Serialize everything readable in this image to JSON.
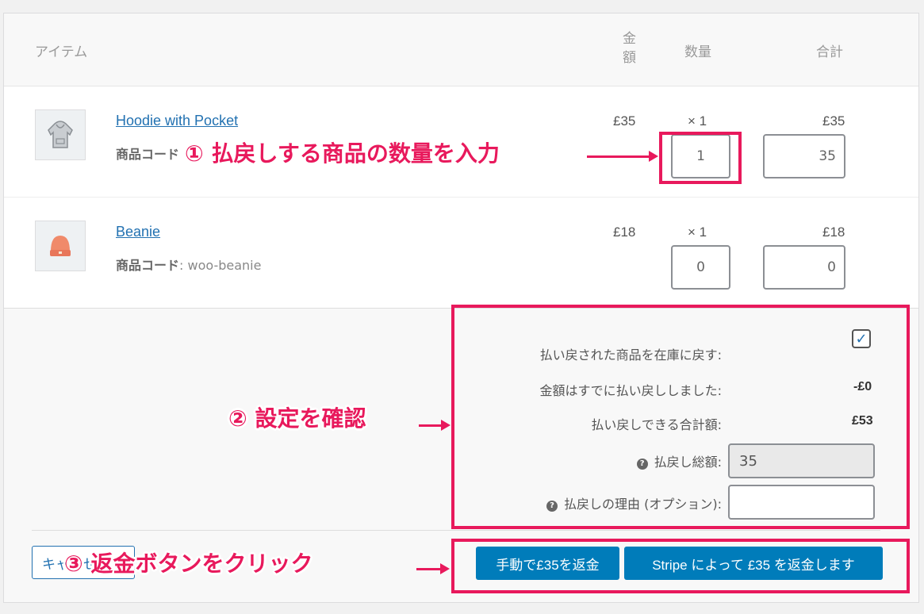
{
  "header": {
    "item": "アイテム",
    "amount": "金額",
    "quantity": "数量",
    "total": "合計"
  },
  "items": [
    {
      "name": "Hoodie with Pocket",
      "sku_label": "商品コード",
      "sku_value": "",
      "price": "£35",
      "qty": "× 1",
      "line_total": "£35",
      "refund_qty": "1",
      "refund_total": "35"
    },
    {
      "name": "Beanie",
      "sku_label": "商品コード",
      "sku_value": ": woo-beanie",
      "price": "£18",
      "qty": "× 1",
      "line_total": "£18",
      "refund_qty": "0",
      "refund_total": "0"
    }
  ],
  "refund": {
    "restock_label": "払い戻された商品を在庫に戻す:",
    "restock_checked": true,
    "already_refunded_label": "金額はすでに払い戻ししました:",
    "already_refunded_value": "-£0",
    "available_label": "払い戻しできる合計額:",
    "available_value": "£53",
    "amount_label": "払戻し総額:",
    "amount_value": "35",
    "reason_label": "払戻しの理由 (オプション):",
    "reason_value": ""
  },
  "buttons": {
    "cancel": "キャンセル",
    "manual": "手動で£35を返金",
    "stripe": "Stripe によって £35 を返金します"
  },
  "annotations": {
    "step1": "① 払戻しする商品の数量を入力",
    "step2": "② 設定を確認",
    "step3": "③ 返金ボタンをクリック"
  },
  "colors": {
    "accent": "#e8195c",
    "primary_button": "#007cba",
    "link": "#2271b1"
  },
  "icons": {
    "help": "question-circle-icon",
    "check": "checkmark-icon"
  }
}
